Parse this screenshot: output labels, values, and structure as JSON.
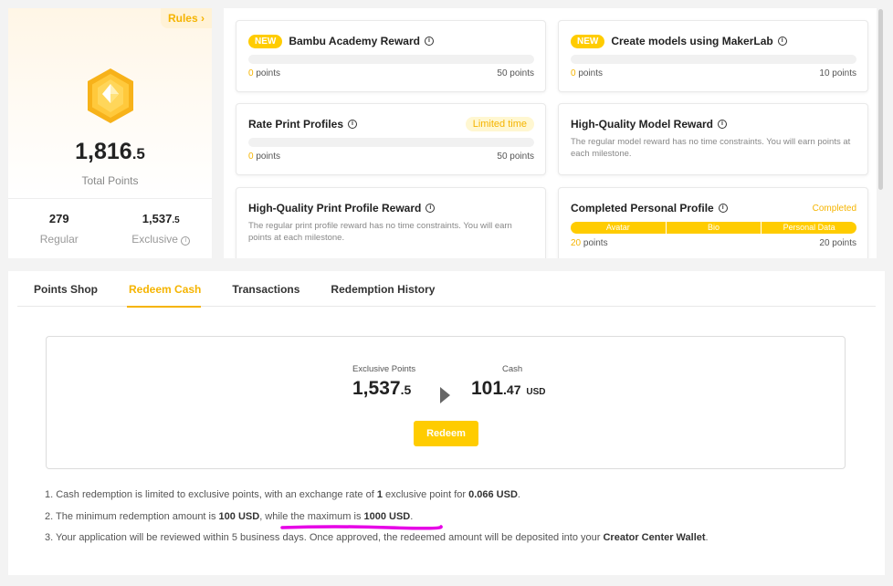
{
  "points_summary": {
    "rules_label": "Rules",
    "rules_arrow": "›",
    "total_int": "1,816",
    "total_dec": ".5",
    "total_label": "Total Points",
    "regular_value": "279",
    "regular_label": "Regular",
    "exclusive_int": "1,537",
    "exclusive_dec": ".5",
    "exclusive_label": "Exclusive",
    "info_glyph": "i"
  },
  "rewards": [
    {
      "badge": "NEW",
      "title": "Bambu Academy Reward",
      "current": "0",
      "current_suffix": " points",
      "target": "50 points",
      "progress": 0
    },
    {
      "badge": "NEW",
      "title": "Create models using MakerLab",
      "current": "0",
      "current_suffix": " points",
      "target": "10 points",
      "progress": 0
    },
    {
      "title": "Rate Print Profiles",
      "tag": "Limited time",
      "current": "0",
      "current_suffix": " points",
      "target": "50 points",
      "progress": 0
    },
    {
      "title": "High-Quality Model Reward",
      "description": "The regular model reward has no time constraints. You will earn points at each milestone."
    },
    {
      "title": "High-Quality Print Profile Reward",
      "description": "The regular print profile reward has no time constraints. You will earn points at each milestone."
    },
    {
      "title": "Completed Personal Profile",
      "status": "Completed",
      "segments": [
        "Avatar",
        "Bio",
        "Personal Data"
      ],
      "current": "20",
      "current_suffix": " points",
      "target": "20 points",
      "progress": 1
    }
  ],
  "tabs": [
    "Points Shop",
    "Redeem Cash",
    "Transactions",
    "Redemption History"
  ],
  "active_tab": "Redeem Cash",
  "redeem": {
    "from_label": "Exclusive Points",
    "from_int": "1,537",
    "from_dec": ".5",
    "to_label": "Cash",
    "to_int": "101",
    "to_dec": ".47",
    "to_unit": "USD",
    "button_label": "Redeem"
  },
  "notes": {
    "n1": {
      "a": "1. Cash redemption is limited to exclusive points, with an exchange rate of ",
      "b1": "1",
      "c": " exclusive point for ",
      "b2": "0.066 USD",
      "d": "."
    },
    "n2": {
      "a": "2. The minimum redemption amount is ",
      "b1": "100 USD",
      "c": ", while the maximum is ",
      "b2": "1000 USD",
      "d": "."
    },
    "n3": {
      "a": "3. Your application will be reviewed within 5 business days. Once approved, the redeemed amount will be deposited into your ",
      "b1": "Creator Center Wallet",
      "d": "."
    }
  },
  "colors": {
    "accent": "#ffcc00",
    "accent_text": "#f5b400",
    "annotation": "#e600e6"
  }
}
